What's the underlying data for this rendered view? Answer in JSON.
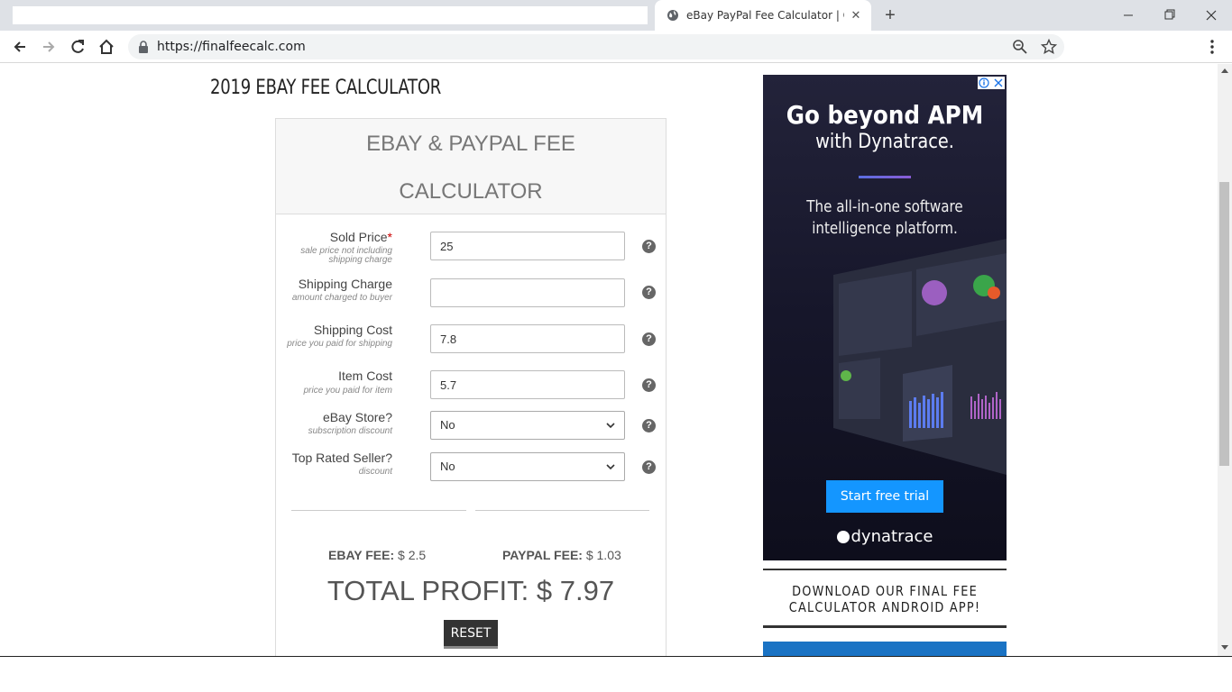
{
  "browser": {
    "tab_title": "eBay PayPal Fee Calculator | Calc",
    "new_tab_label": "+",
    "url": "https://finalfeecalc.com"
  },
  "page": {
    "heading": "2019 EBAY FEE CALCULATOR"
  },
  "calculator": {
    "title_line1": "EBAY & PAYPAL FEE",
    "title_line2": "CALCULATOR",
    "fields": {
      "sold_price": {
        "label": "Sold Price",
        "required_mark": "*",
        "hint": "sale price not including shipping charge",
        "value": "25"
      },
      "shipping_charge": {
        "label": "Shipping Charge",
        "hint": "amount charged to buyer",
        "value": ""
      },
      "shipping_cost": {
        "label": "Shipping Cost",
        "hint": "price you paid for shipping",
        "value": "7.8"
      },
      "item_cost": {
        "label": "Item Cost",
        "hint": "price you paid for item",
        "value": "5.7"
      },
      "ebay_store": {
        "label": "eBay Store?",
        "hint": "subscription discount",
        "selected": "No"
      },
      "top_rated": {
        "label": "Top Rated Seller?",
        "hint": "discount",
        "selected": "No"
      }
    },
    "help_glyph": "?",
    "ebay_fee_label": "EBAY FEE:",
    "ebay_fee_value": "$ 2.5",
    "paypal_fee_label": "PAYPAL FEE:",
    "paypal_fee_value": "$ 1.03",
    "total_profit": "TOTAL PROFIT: $ 7.97",
    "reset_label": "RESET"
  },
  "ad": {
    "headline_1": "Go beyond APM",
    "headline_2": "with Dynatrace.",
    "sub_1": "The all-in-one software",
    "sub_2": "intelligence platform.",
    "cta": "Start free trial",
    "brand": "dynatrace"
  },
  "sidebar": {
    "app_title": "DOWNLOAD OUR FINAL FEE CALCULATOR ANDROID APP!"
  },
  "colors": {
    "accent_blue": "#1496ff",
    "required": "#cc0000",
    "reset_bg": "#333333"
  }
}
